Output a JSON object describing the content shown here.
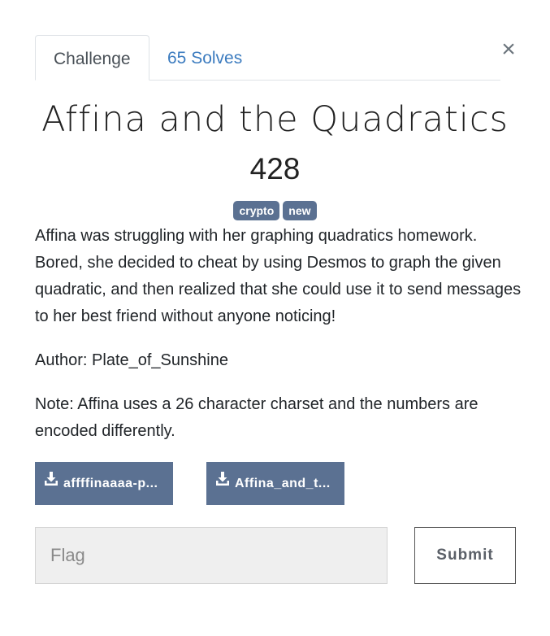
{
  "tabs": {
    "challenge": "Challenge",
    "solves": "65 Solves"
  },
  "close_symbol": "×",
  "challenge": {
    "title": "Affina and the Quadratics",
    "points": "428",
    "tags": [
      "crypto",
      "new"
    ],
    "description": [
      "Affina was struggling with her graphing quadratics homework. Bored, she decided to cheat by using Desmos to graph the given quadratic, and then realized that she could use it to send messages to her best friend without anyone noticing!",
      "Author: Plate_of_Sunshine",
      "Note: Affina uses a 26 character charset and the numbers are encoded differently."
    ]
  },
  "files": [
    {
      "label": "affffinaaaa-p...",
      "icon": "download-icon"
    },
    {
      "label": "Affina_and_t...",
      "icon": "download-icon"
    }
  ],
  "flag_form": {
    "placeholder": "Flag",
    "value": "",
    "submit_label": "Submit"
  },
  "colors": {
    "badge": "#5b7192",
    "link": "#3b7bbf",
    "file_button": "#5b7192"
  }
}
